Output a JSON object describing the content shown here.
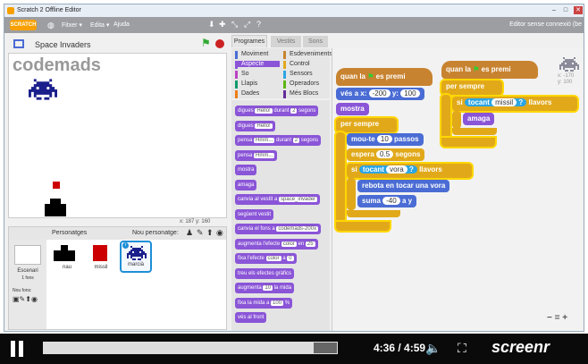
{
  "window": {
    "title": "Scratch 2 Offline Editor"
  },
  "menu": {
    "logo": "SCRATCH",
    "items": [
      "Fitxer ▾",
      "Edita ▾",
      "Ajuda"
    ],
    "offline": "Editor sense connexió (be"
  },
  "stage": {
    "project_name": "Space Invaders",
    "brand": "codemads",
    "coords": {
      "x_label": "x:",
      "x": "187",
      "y_label": "y:",
      "y": "160"
    }
  },
  "sprites_panel": {
    "title": "Personatges",
    "new_label": "Nou personatge:",
    "stage_label": "Escenari",
    "stage_sub": "1 fons",
    "new_bg_label": "Nou fons:",
    "sprites": [
      {
        "name": "nau"
      },
      {
        "name": "missil"
      },
      {
        "name": "marcià"
      }
    ]
  },
  "tabs": [
    "Programes",
    "Vestits",
    "Sons"
  ],
  "categories": [
    {
      "label": "Moviment",
      "color": "#4a6cd4"
    },
    {
      "label": "Esdeveniments",
      "color": "#c88330"
    },
    {
      "label": "Aspecte",
      "color": "#8a55d7"
    },
    {
      "label": "Control",
      "color": "#e1a91a"
    },
    {
      "label": "So",
      "color": "#bb42c3"
    },
    {
      "label": "Sensors",
      "color": "#2ca5e2"
    },
    {
      "label": "Llapis",
      "color": "#0e9a6c"
    },
    {
      "label": "Operadors",
      "color": "#5cb712"
    },
    {
      "label": "Dades",
      "color": "#ee7d16"
    },
    {
      "label": "Més Blocs",
      "color": "#632d99"
    }
  ],
  "palette": [
    {
      "t": "digues",
      "a": "Hello!",
      "b": "durant",
      "c": "2",
      "d": "segons"
    },
    {
      "t": "digues",
      "a": "Hello!"
    },
    {
      "t": "pensa",
      "a": "Hmm...",
      "b": "durant",
      "c": "2",
      "d": "segons"
    },
    {
      "t": "pensa",
      "a": "Hmm..."
    },
    {
      "t": "mostra"
    },
    {
      "t": "amaga"
    },
    {
      "t": "canvia al vestit a",
      "a": "space_invader"
    },
    {
      "t": "següent vestit"
    },
    {
      "t": "canvia el fons a",
      "a": "codemads-200x"
    },
    {
      "t": "augmenta l'efecte",
      "a": "color",
      "b": "en",
      "c": "25"
    },
    {
      "t": "fixa l'efecte",
      "a": "color",
      "b": "a",
      "c": "0"
    },
    {
      "t": "treu els efectes gràfics"
    },
    {
      "t": "augmenta",
      "a": "10",
      "b": "la mida"
    },
    {
      "t": "fixa la mida a",
      "a": "100",
      "b": "%"
    },
    {
      "t": "vés al front"
    }
  ],
  "script1": {
    "hat": "quan la",
    "hat2": "es premi",
    "goto": "vés a x:",
    "gx": "-200",
    "gy_label": "y:",
    "gy": "100",
    "show": "mostra",
    "forever": "per sempre",
    "move": "mou-te",
    "move_n": "10",
    "move_u": "passos",
    "wait": "espera",
    "wait_n": "0.5",
    "wait_u": "segons",
    "if": "si",
    "touch": "tocant",
    "touch_t": "vora",
    "touch_q": "?",
    "illeg": "llavors",
    "bounce": "rebota en tocar una vora",
    "change": "suma",
    "change_n": "-40",
    "change_u": "a y"
  },
  "script2": {
    "hat": "quan la",
    "hat2": "es premi",
    "forever": "per sempre",
    "if": "si",
    "touch": "tocant",
    "touch_t": "missil",
    "touch_q": "?",
    "llavors": "llavors",
    "hide": "amaga"
  },
  "sprite_info": {
    "x": "x: -170",
    "y": "y: 100"
  },
  "zoom": {
    "out": "−",
    "reset": "=",
    "in": "+"
  },
  "player": {
    "time": "4:36 / 4:59",
    "progress": 0.92,
    "brand": "screenr"
  }
}
